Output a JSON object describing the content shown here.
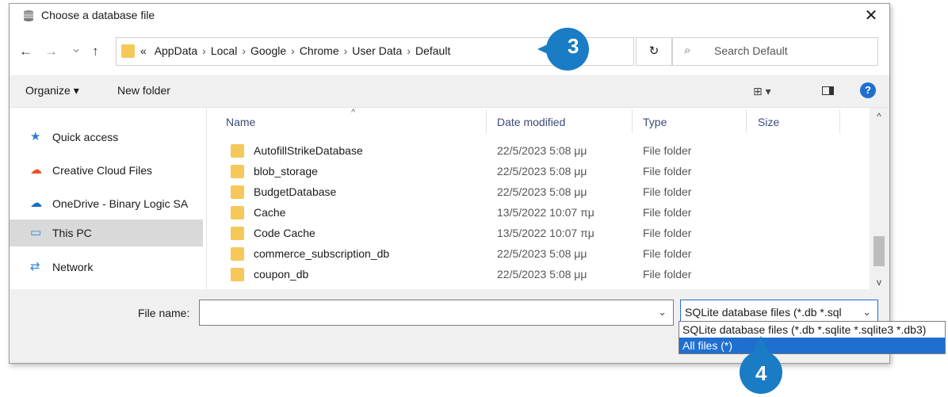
{
  "window": {
    "title": "Choose a database file",
    "close": "✕"
  },
  "nav": {
    "back": "←",
    "forward": "→",
    "recent": "⌄",
    "up": "↑",
    "crumbs": [
      "«",
      "AppData",
      "Local",
      "Google",
      "Chrome",
      "User Data",
      "Default"
    ],
    "sep": "›",
    "address_dropdown": "⌄",
    "refresh": "↻",
    "search_placeholder": "Search Default"
  },
  "toolbar": {
    "organize": "Organize ▾",
    "new_folder": "New folder",
    "view": "⊞ ▾",
    "help": "?"
  },
  "sidebar": {
    "items": [
      {
        "label": "Quick access",
        "icon": "star-icon",
        "glyph": "★",
        "color": "#2f7bd6"
      },
      {
        "label": "Creative Cloud Files",
        "icon": "creative-cloud-icon",
        "glyph": "☁",
        "color": "#e8532b"
      },
      {
        "label": "OneDrive - Binary Logic SA",
        "icon": "onedrive-icon",
        "glyph": "☁",
        "color": "#1a6cc9"
      },
      {
        "label": "This PC",
        "icon": "computer-icon",
        "glyph": "▭",
        "color": "#2e86d6"
      },
      {
        "label": "Network",
        "icon": "network-icon",
        "glyph": "⇄",
        "color": "#2e86d6"
      }
    ]
  },
  "columns": {
    "name": "Name",
    "date": "Date modified",
    "type": "Type",
    "size": "Size",
    "sort": "^"
  },
  "files": [
    {
      "name": "AutofillStrikeDatabase",
      "date": "22/5/2023 5:08 μμ",
      "type": "File folder"
    },
    {
      "name": "blob_storage",
      "date": "22/5/2023 5:08 μμ",
      "type": "File folder"
    },
    {
      "name": "BudgetDatabase",
      "date": "22/5/2023 5:08 μμ",
      "type": "File folder"
    },
    {
      "name": "Cache",
      "date": "13/5/2022 10:07 πμ",
      "type": "File folder"
    },
    {
      "name": "Code Cache",
      "date": "13/5/2022 10:07 πμ",
      "type": "File folder"
    },
    {
      "name": "commerce_subscription_db",
      "date": "22/5/2023 5:08 μμ",
      "type": "File folder"
    },
    {
      "name": "coupon_db",
      "date": "22/5/2023 5:08 μμ",
      "type": "File folder"
    }
  ],
  "bottom": {
    "file_name_label": "File name:",
    "file_name_value": "",
    "file_type_selected": "SQLite database files (*.db *.sql",
    "dropdown_caret": "⌄"
  },
  "type_options": [
    "SQLite database files (*.db *.sqlite *.sqlite3 *.db3)",
    "All files  (*)"
  ],
  "callouts": {
    "step3": "3",
    "step4": "4"
  },
  "colors": {
    "accent": "#1f6fd1",
    "badge": "#1a7cc4",
    "folder": "#f6c85a"
  }
}
